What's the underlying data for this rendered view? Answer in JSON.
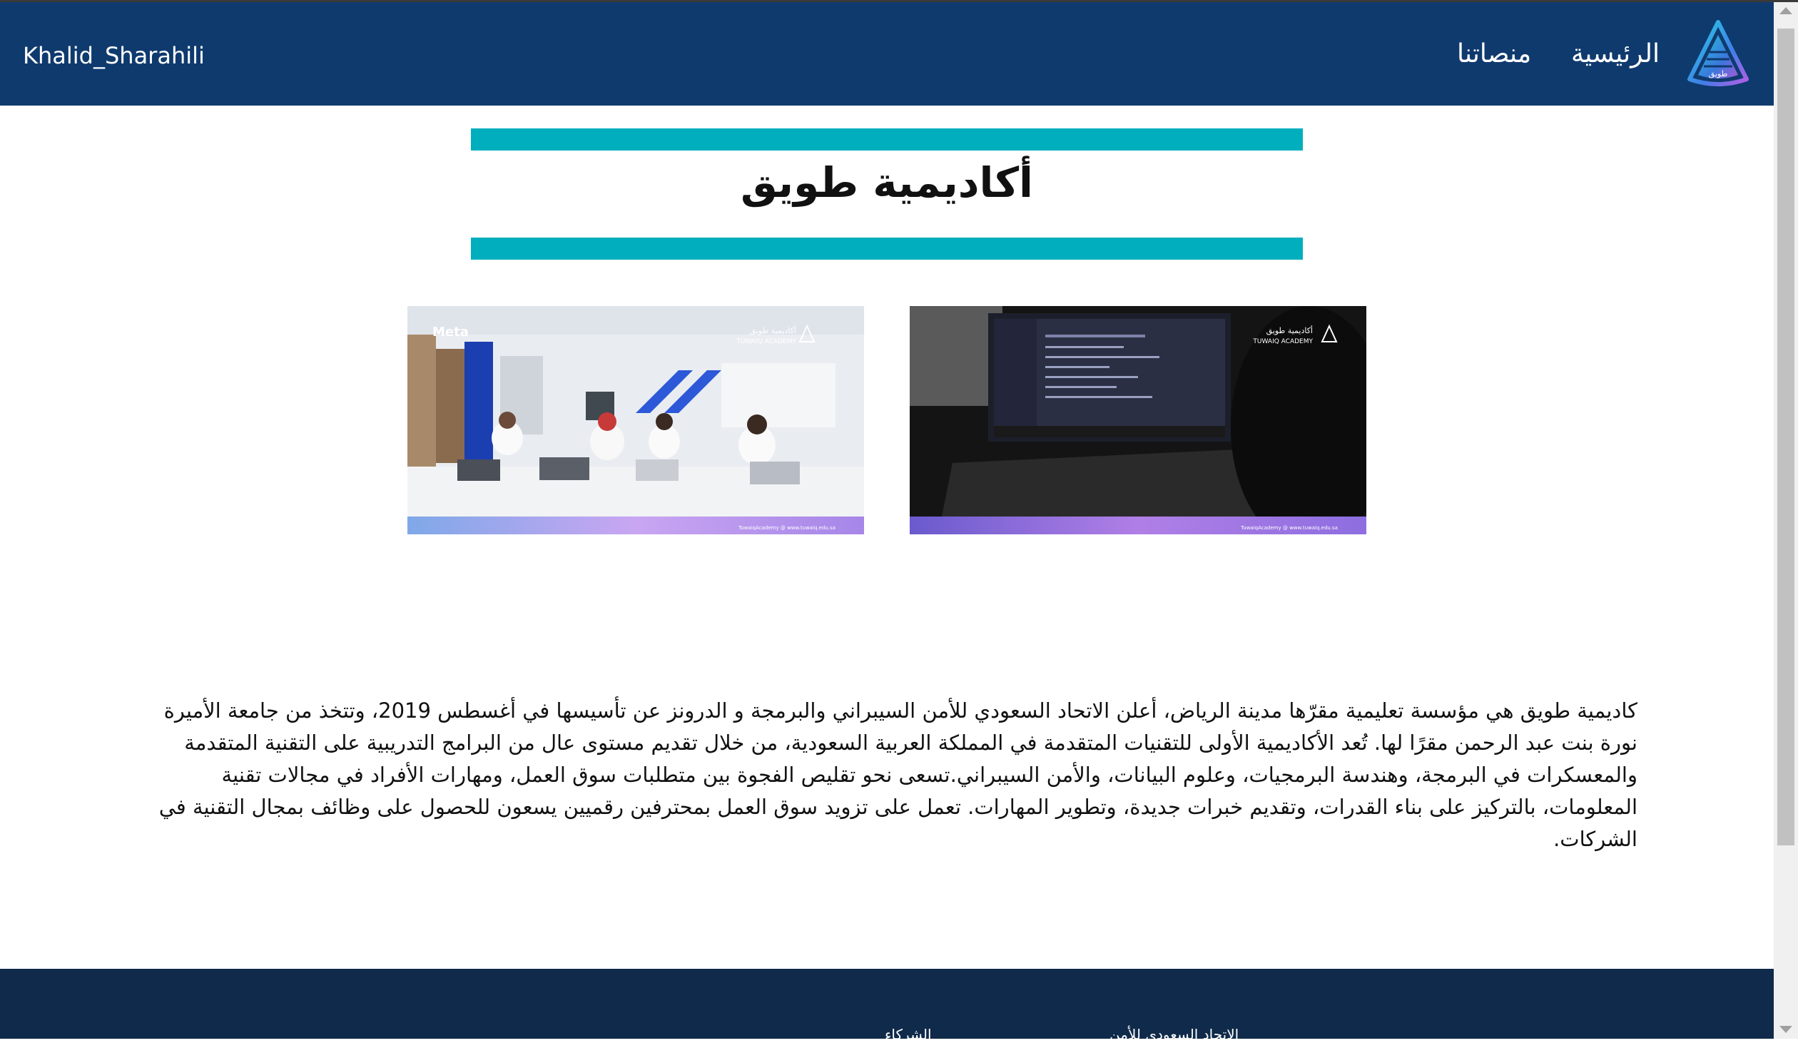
{
  "navbar": {
    "brand": "Khalid_Sharahili",
    "links": [
      "الرئيسية",
      "منصاتنا"
    ],
    "logo_icon": "tuwaiq-logo-icon",
    "logo_text": "طويق"
  },
  "hero": {
    "title": "أكاديمية طويق"
  },
  "gallery": {
    "photos": [
      {
        "name": "classroom-photo",
        "partner_label": "Meta",
        "academy_ar": "أكاديمية طويق",
        "academy_en": "TUWAIQ ACADEMY",
        "social": "TuwaiqAcademy @ www.tuwaiq.edu.sa"
      },
      {
        "name": "laptop-photo",
        "academy_ar": "أكاديمية طويق",
        "academy_en": "TUWAIQ ACADEMY",
        "social": "TuwaiqAcademy @ www.tuwaiq.edu.sa"
      }
    ]
  },
  "about": {
    "text": "كاديمية طويق هي مؤسسة تعليمية مقرّها مدينة الرياض، أعلن الاتحاد السعودي للأمن السيبراني والبرمجة و الدرونز عن تأسيسها في أغسطس 2019، وتتخذ من جامعة الأميرة نورة بنت عبد الرحمن مقرًا لها. تُعد الأكاديمية الأولى للتقنيات المتقدمة في المملكة العربية السعودية، من خلال تقديم مستوى عال من البرامج التدريبية على التقنية المتقدمة والمعسكرات في البرمجة، وهندسة البرمجيات، وعلوم البيانات، والأمن السيبراني.تسعى نحو تقليص الفجوة بين متطلبات سوق العمل، ومهارات الأفراد في مجالات تقنية المعلومات، بالتركيز على بناء القدرات، وتقديم خبرات جديدة، وتطوير المهارات. تعمل على تزويد سوق العمل بمحترفين رقميين يسعون للحصول على وظائف بمجال التقنية في الشركات."
  },
  "footer": {
    "items": [
      "الاتحاد السعودي للأمن",
      "الشركاء"
    ]
  },
  "colors": {
    "navbar": "#0f3a6e",
    "accent_band": "#00aebd",
    "footer": "#0f2a4a"
  }
}
